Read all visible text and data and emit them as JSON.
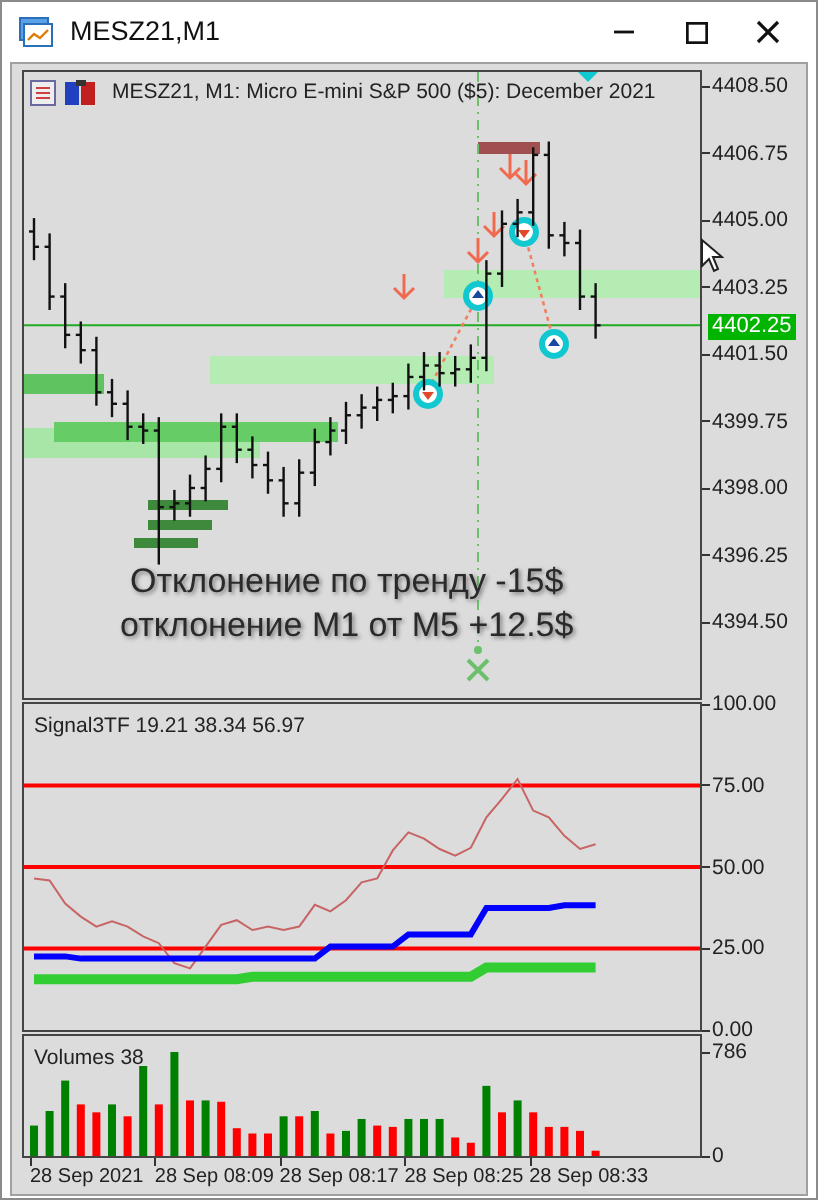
{
  "window": {
    "title": "MESZ21,M1"
  },
  "price_pane": {
    "title": "MESZ21, M1:  Micro E-mini S&P 500 ($5): December 2021",
    "axis_labels": [
      "4408.50",
      "4406.75",
      "4405.00",
      "4403.25",
      "4401.50",
      "4399.75",
      "4398.00",
      "4396.25",
      "4394.50"
    ],
    "current_price": "4402.25",
    "notes": [
      "Отклонение по тренду -15$",
      "отклонение M1 от M5 +12.5$"
    ]
  },
  "indicator_pane": {
    "chart_data": {
      "type": "line",
      "title": "Signal3TF 19.21 38.34 56.97",
      "ylim": [
        0,
        100
      ],
      "grid": true,
      "yticks": [
        {
          "value": 100,
          "label": "100.00"
        },
        {
          "value": 75,
          "label": "75.00"
        },
        {
          "value": 50,
          "label": "50.00"
        },
        {
          "value": 25,
          "label": "25.00"
        },
        {
          "value": 0,
          "label": "0.00"
        }
      ],
      "series": [
        {
          "color": "#c86464",
          "values": [
            46.5,
            45.9,
            38.8,
            34.8,
            31.7,
            33.3,
            31.7,
            28.7,
            26.6,
            20.5,
            18.9,
            25.6,
            32.3,
            33.7,
            30.7,
            31.7,
            30.7,
            31.7,
            38.4,
            36.4,
            39.8,
            45.3,
            46.5,
            55.1,
            60.6,
            58.7,
            55.5,
            53.5,
            55.9,
            65.2,
            70.9,
            77.0,
            67.3,
            65.2,
            59.6,
            55.5,
            57.0
          ]
        },
        {
          "color": "#0000ff",
          "values": [
            22.6,
            22.6,
            22.6,
            21.9,
            21.9,
            21.9,
            21.9,
            21.9,
            21.9,
            21.9,
            21.9,
            21.9,
            21.9,
            21.9,
            21.9,
            21.9,
            21.9,
            21.9,
            21.9,
            25.6,
            25.6,
            25.6,
            25.6,
            25.6,
            29.3,
            29.3,
            29.3,
            29.3,
            29.3,
            37.4,
            37.4,
            37.4,
            37.4,
            37.4,
            38.3,
            38.3,
            38.3
          ]
        },
        {
          "color": "#32cd32",
          "values": [
            15.6,
            15.6,
            15.6,
            15.6,
            15.6,
            15.6,
            15.6,
            15.6,
            15.6,
            15.6,
            15.6,
            15.6,
            15.6,
            15.6,
            16.3,
            16.3,
            16.3,
            16.3,
            16.3,
            16.3,
            16.3,
            16.3,
            16.3,
            16.3,
            16.3,
            16.3,
            16.3,
            16.3,
            16.3,
            19.2,
            19.2,
            19.2,
            19.2,
            19.2,
            19.2,
            19.2,
            19.2
          ]
        }
      ]
    }
  },
  "volume_pane": {
    "chart_data": {
      "type": "bar",
      "title": "Volumes 38",
      "ylim": [
        0,
        786
      ],
      "yticks": [
        {
          "value": 786,
          "label": "786"
        },
        {
          "value": 0,
          "label": "0"
        }
      ],
      "series": [
        {
          "color": "#008000",
          "values": [
            230,
            340,
            570,
            null,
            null,
            390,
            null,
            680,
            null,
            786,
            null,
            420,
            null,
            null,
            null,
            null,
            300,
            null,
            340,
            null,
            190,
            280,
            null,
            null,
            280,
            280,
            280,
            null,
            null,
            530,
            null,
            420,
            null,
            null,
            null,
            null,
            null
          ]
        },
        {
          "color": "#ff0000",
          "values": [
            null,
            null,
            null,
            390,
            330,
            null,
            300,
            null,
            390,
            null,
            420,
            null,
            410,
            210,
            170,
            170,
            null,
            300,
            null,
            170,
            null,
            null,
            230,
            220,
            null,
            null,
            null,
            140,
            100,
            null,
            330,
            null,
            330,
            220,
            220,
            190,
            40
          ]
        }
      ]
    }
  },
  "time_axis": [
    "28 Sep 2021",
    "28 Sep 08:09",
    "28 Sep 08:17",
    "28 Sep 08:25",
    "28 Sep 08:33"
  ]
}
